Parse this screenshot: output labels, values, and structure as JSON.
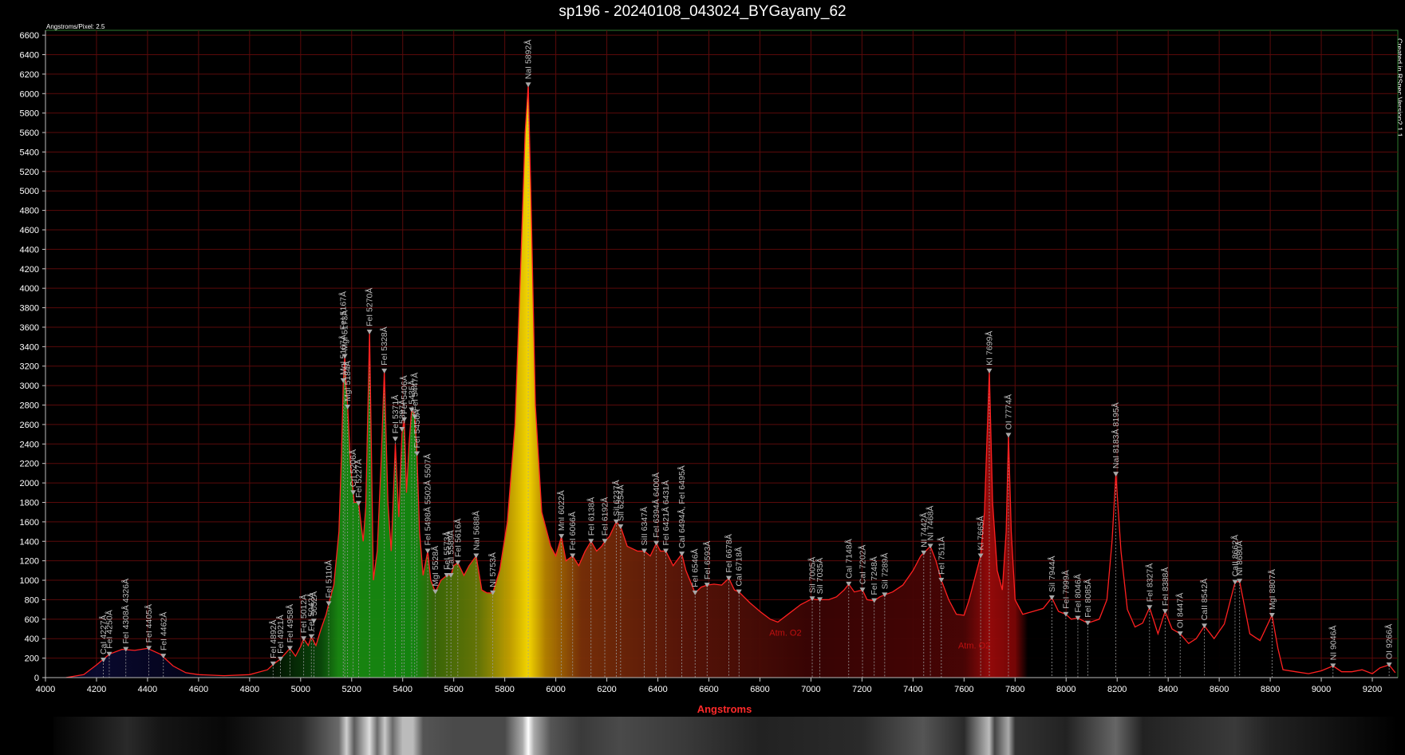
{
  "title": "sp196 - 20240108_043024_BYGayany_62",
  "subtitle": "Angstroms/Pixel: 2.5",
  "app_version": "Created in RSpec Version2.1.1",
  "colors": {
    "background": "#000000",
    "grid": "#5a0a0a",
    "spectrum_line": "#ff2020",
    "frame": "#2e7d2e",
    "axis_label": "#ff2a2a",
    "line_label": "#bdbdbd"
  },
  "chart_data": {
    "type": "line",
    "title": "sp196 - 20240108_043024_BYGayany_62",
    "xlabel": "Angstroms",
    "ylabel": "",
    "xlim": [
      4000,
      9300
    ],
    "ylim": [
      0,
      6650
    ],
    "grid": true,
    "x_ticks": [
      4000,
      4200,
      4400,
      4600,
      4800,
      5000,
      5200,
      5400,
      5600,
      5800,
      6000,
      6200,
      6400,
      6600,
      6800,
      7000,
      7200,
      7400,
      7600,
      7800,
      8000,
      8200,
      8400,
      8600,
      8800,
      9000,
      9200
    ],
    "y_ticks": [
      0,
      200,
      400,
      600,
      800,
      1000,
      1200,
      1400,
      1600,
      1800,
      2000,
      2200,
      2400,
      2600,
      2800,
      3000,
      3200,
      3400,
      3600,
      3800,
      4000,
      4200,
      4400,
      4600,
      4800,
      5000,
      5200,
      5400,
      5600,
      5800,
      6000,
      6200,
      6400,
      6600
    ],
    "series": [
      {
        "points": [
          [
            4080,
            0
          ],
          [
            4150,
            30
          ],
          [
            4200,
            130
          ],
          [
            4250,
            240
          ],
          [
            4300,
            290
          ],
          [
            4350,
            280
          ],
          [
            4400,
            300
          ],
          [
            4450,
            240
          ],
          [
            4500,
            120
          ],
          [
            4550,
            50
          ],
          [
            4600,
            30
          ],
          [
            4700,
            20
          ],
          [
            4800,
            30
          ],
          [
            4870,
            80
          ],
          [
            4895,
            140
          ],
          [
            4921,
            190
          ],
          [
            4958,
            300
          ],
          [
            4980,
            220
          ],
          [
            5000,
            320
          ],
          [
            5012,
            400
          ],
          [
            5030,
            330
          ],
          [
            5042,
            420
          ],
          [
            5060,
            330
          ],
          [
            5080,
            500
          ],
          [
            5100,
            650
          ],
          [
            5110,
            760
          ],
          [
            5130,
            950
          ],
          [
            5150,
            1500
          ],
          [
            5160,
            2300
          ],
          [
            5167,
            3000
          ],
          [
            5173,
            3300
          ],
          [
            5178,
            3000
          ],
          [
            5184,
            2800
          ],
          [
            5195,
            2200
          ],
          [
            5210,
            1800
          ],
          [
            5227,
            1800
          ],
          [
            5245,
            1400
          ],
          [
            5255,
            1750
          ],
          [
            5270,
            3550
          ],
          [
            5285,
            1000
          ],
          [
            5300,
            1300
          ],
          [
            5315,
            2200
          ],
          [
            5328,
            3150
          ],
          [
            5342,
            1800
          ],
          [
            5355,
            1300
          ],
          [
            5371,
            2400
          ],
          [
            5385,
            1650
          ],
          [
            5397,
            2500
          ],
          [
            5406,
            2650
          ],
          [
            5415,
            1900
          ],
          [
            5425,
            2400
          ],
          [
            5435,
            2750
          ],
          [
            5447,
            2700
          ],
          [
            5456,
            2300
          ],
          [
            5466,
            1500
          ],
          [
            5480,
            1050
          ],
          [
            5498,
            1300
          ],
          [
            5510,
            1000
          ],
          [
            5528,
            880
          ],
          [
            5550,
            1000
          ],
          [
            5573,
            1050
          ],
          [
            5589,
            1050
          ],
          [
            5600,
            1150
          ],
          [
            5616,
            1180
          ],
          [
            5640,
            1050
          ],
          [
            5660,
            1150
          ],
          [
            5688,
            1250
          ],
          [
            5710,
            900
          ],
          [
            5730,
            870
          ],
          [
            5753,
            870
          ],
          [
            5780,
            1100
          ],
          [
            5810,
            1600
          ],
          [
            5840,
            2600
          ],
          [
            5862,
            4200
          ],
          [
            5880,
            5600
          ],
          [
            5892,
            6090
          ],
          [
            5902,
            5000
          ],
          [
            5920,
            2800
          ],
          [
            5945,
            1700
          ],
          [
            5980,
            1350
          ],
          [
            6000,
            1250
          ],
          [
            6022,
            1450
          ],
          [
            6040,
            1200
          ],
          [
            6066,
            1250
          ],
          [
            6090,
            1150
          ],
          [
            6115,
            1300
          ],
          [
            6138,
            1400
          ],
          [
            6160,
            1300
          ],
          [
            6180,
            1350
          ],
          [
            6192,
            1400
          ],
          [
            6210,
            1450
          ],
          [
            6237,
            1600
          ],
          [
            6254,
            1550
          ],
          [
            6280,
            1350
          ],
          [
            6320,
            1300
          ],
          [
            6347,
            1300
          ],
          [
            6370,
            1250
          ],
          [
            6394,
            1380
          ],
          [
            6410,
            1300
          ],
          [
            6431,
            1300
          ],
          [
            6460,
            1150
          ],
          [
            6494,
            1270
          ],
          [
            6510,
            1100
          ],
          [
            6546,
            870
          ],
          [
            6570,
            930
          ],
          [
            6593,
            950
          ],
          [
            6620,
            960
          ],
          [
            6650,
            950
          ],
          [
            6678,
            1020
          ],
          [
            6700,
            900
          ],
          [
            6718,
            880
          ],
          [
            6760,
            770
          ],
          [
            6800,
            680
          ],
          [
            6840,
            600
          ],
          [
            6870,
            570
          ],
          [
            6910,
            650
          ],
          [
            6960,
            750
          ],
          [
            7005,
            810
          ],
          [
            7020,
            800
          ],
          [
            7035,
            800
          ],
          [
            7070,
            800
          ],
          [
            7100,
            830
          ],
          [
            7130,
            900
          ],
          [
            7148,
            960
          ],
          [
            7170,
            880
          ],
          [
            7202,
            900
          ],
          [
            7220,
            800
          ],
          [
            7248,
            790
          ],
          [
            7270,
            830
          ],
          [
            7289,
            850
          ],
          [
            7320,
            880
          ],
          [
            7360,
            950
          ],
          [
            7400,
            1100
          ],
          [
            7430,
            1250
          ],
          [
            7442,
            1280
          ],
          [
            7468,
            1350
          ],
          [
            7490,
            1200
          ],
          [
            7511,
            1000
          ],
          [
            7540,
            800
          ],
          [
            7570,
            650
          ],
          [
            7600,
            640
          ],
          [
            7620,
            800
          ],
          [
            7640,
            1000
          ],
          [
            7665,
            1250
          ],
          [
            7680,
            1700
          ],
          [
            7699,
            3150
          ],
          [
            7712,
            1800
          ],
          [
            7730,
            1100
          ],
          [
            7750,
            900
          ],
          [
            7765,
            1500
          ],
          [
            7774,
            2490
          ],
          [
            7785,
            1500
          ],
          [
            7800,
            800
          ],
          [
            7830,
            650
          ],
          [
            7870,
            680
          ],
          [
            7910,
            710
          ],
          [
            7944,
            820
          ],
          [
            7970,
            680
          ],
          [
            7999,
            650
          ],
          [
            8020,
            600
          ],
          [
            8046,
            610
          ],
          [
            8085,
            560
          ],
          [
            8130,
            600
          ],
          [
            8160,
            800
          ],
          [
            8180,
            1400
          ],
          [
            8195,
            2090
          ],
          [
            8215,
            1300
          ],
          [
            8240,
            700
          ],
          [
            8270,
            520
          ],
          [
            8300,
            560
          ],
          [
            8327,
            720
          ],
          [
            8360,
            450
          ],
          [
            8388,
            680
          ],
          [
            8415,
            500
          ],
          [
            8447,
            450
          ],
          [
            8480,
            350
          ],
          [
            8510,
            400
          ],
          [
            8542,
            530
          ],
          [
            8580,
            400
          ],
          [
            8620,
            550
          ],
          [
            8662,
            980
          ],
          [
            8680,
            990
          ],
          [
            8720,
            450
          ],
          [
            8760,
            380
          ],
          [
            8807,
            640
          ],
          [
            8830,
            300
          ],
          [
            8850,
            80
          ],
          [
            8900,
            60
          ],
          [
            8950,
            40
          ],
          [
            9000,
            70
          ],
          [
            9046,
            120
          ],
          [
            9080,
            60
          ],
          [
            9120,
            60
          ],
          [
            9160,
            80
          ],
          [
            9200,
            40
          ],
          [
            9230,
            100
          ],
          [
            9266,
            130
          ],
          [
            9290,
            50
          ]
        ]
      }
    ],
    "markers": [
      {
        "x": 4227,
        "y": 180,
        "label": "CaI 4227Å"
      },
      {
        "x": 4250,
        "y": 240,
        "label": "FeI 4250Å"
      },
      {
        "x": 4315,
        "y": 290,
        "label": "FeI 4308Å 4326Å"
      },
      {
        "x": 4405,
        "y": 300,
        "label": "FeI 4405Å"
      },
      {
        "x": 4462,
        "y": 220,
        "label": "FeI 4462Å"
      },
      {
        "x": 4892,
        "y": 140,
        "label": "FeI 4892Å"
      },
      {
        "x": 4921,
        "y": 190,
        "label": "FeI 4921Å"
      },
      {
        "x": 4958,
        "y": 300,
        "label": "FeI 4958Å"
      },
      {
        "x": 5012,
        "y": 400,
        "label": "FeI 5012Å"
      },
      {
        "x": 5042,
        "y": 420,
        "label": "FeI 5042Å"
      },
      {
        "x": 5052,
        "y": 580,
        "label": "5052Å"
      },
      {
        "x": 5110,
        "y": 760,
        "label": "FeI 5110Å"
      },
      {
        "x": 5167,
        "y": 3050,
        "label": "MgI 5167Å, FeI 5167Å"
      },
      {
        "x": 5173,
        "y": 3300,
        "label": "MgI 5173Å"
      },
      {
        "x": 5184,
        "y": 2780,
        "label": "MgI 5184Å"
      },
      {
        "x": 5206,
        "y": 1900,
        "label": "CrI 5206Å"
      },
      {
        "x": 5227,
        "y": 1790,
        "label": "FeI 5227Å"
      },
      {
        "x": 5270,
        "y": 3550,
        "label": "FeI 5270Å"
      },
      {
        "x": 5328,
        "y": 3150,
        "label": "FeI 5328Å"
      },
      {
        "x": 5371,
        "y": 2450,
        "label": "FeI 5371Å"
      },
      {
        "x": 5397,
        "y": 2550,
        "label": "5397Å"
      },
      {
        "x": 5406,
        "y": 2650,
        "label": "FeI 5406Å"
      },
      {
        "x": 5435,
        "y": 2750,
        "label": "5435Å"
      },
      {
        "x": 5447,
        "y": 2680,
        "label": "FeI 5447Å"
      },
      {
        "x": 5456,
        "y": 2300,
        "label": "FeI 5456Å"
      },
      {
        "x": 5498,
        "y": 1300,
        "label": "FeI 5498Å 5502Å 5507Å"
      },
      {
        "x": 5528,
        "y": 880,
        "label": "MgI 5528Å"
      },
      {
        "x": 5573,
        "y": 1050,
        "label": "FeI 5573Å"
      },
      {
        "x": 5589,
        "y": 1050,
        "label": "CaI 5589Å"
      },
      {
        "x": 5616,
        "y": 1180,
        "label": "FeI 5616Å"
      },
      {
        "x": 5688,
        "y": 1250,
        "label": "NaI 5688Å"
      },
      {
        "x": 5753,
        "y": 870,
        "label": "NI 5753Å"
      },
      {
        "x": 5892,
        "y": 6090,
        "label": "NaI 5892Å"
      },
      {
        "x": 6022,
        "y": 1450,
        "label": "MnI 6022Å"
      },
      {
        "x": 6066,
        "y": 1250,
        "label": "FeI 6066Å"
      },
      {
        "x": 6138,
        "y": 1400,
        "label": "FeI 6138Å"
      },
      {
        "x": 6192,
        "y": 1400,
        "label": "FeI 6192Å"
      },
      {
        "x": 6237,
        "y": 1600,
        "label": "SiI 6237Å"
      },
      {
        "x": 6254,
        "y": 1550,
        "label": "SiI 6254Å"
      },
      {
        "x": 6347,
        "y": 1300,
        "label": "SiII 6347Å"
      },
      {
        "x": 6394,
        "y": 1380,
        "label": "FeI 6394Å 6400Å"
      },
      {
        "x": 6431,
        "y": 1300,
        "label": "FeI 6421Å 6431Å"
      },
      {
        "x": 6494,
        "y": 1270,
        "label": "CaI 6494Å, FeI 6495Å"
      },
      {
        "x": 6546,
        "y": 870,
        "label": "FeI 6546Å"
      },
      {
        "x": 6593,
        "y": 950,
        "label": "FeI 6593Å"
      },
      {
        "x": 6678,
        "y": 1020,
        "label": "FeI 6678Å"
      },
      {
        "x": 6718,
        "y": 880,
        "label": "CaI 6718Å"
      },
      {
        "x": 7005,
        "y": 810,
        "label": "SiI 7005Å"
      },
      {
        "x": 7035,
        "y": 800,
        "label": "SiI 7035Å"
      },
      {
        "x": 7148,
        "y": 960,
        "label": "CaI 7148Å"
      },
      {
        "x": 7202,
        "y": 900,
        "label": "CaI 7202Å"
      },
      {
        "x": 7248,
        "y": 790,
        "label": "FeI 7248Å"
      },
      {
        "x": 7289,
        "y": 850,
        "label": "SiI 7289Å"
      },
      {
        "x": 7442,
        "y": 1280,
        "label": "NI 7442Å"
      },
      {
        "x": 7468,
        "y": 1350,
        "label": "NI 7468Å"
      },
      {
        "x": 7511,
        "y": 1000,
        "label": "FeI 7511Å"
      },
      {
        "x": 7665,
        "y": 1250,
        "label": "KI 7665Å"
      },
      {
        "x": 7699,
        "y": 3150,
        "label": "KI 7699Å"
      },
      {
        "x": 7774,
        "y": 2490,
        "label": "OI 7774Å"
      },
      {
        "x": 7944,
        "y": 820,
        "label": "SiI 7944Å"
      },
      {
        "x": 7999,
        "y": 650,
        "label": "FeI 7999Å"
      },
      {
        "x": 8046,
        "y": 610,
        "label": "FeI 8046Å"
      },
      {
        "x": 8085,
        "y": 560,
        "label": "FeI 8085Å"
      },
      {
        "x": 8195,
        "y": 2090,
        "label": "NaI 8183Å 8195Å"
      },
      {
        "x": 8327,
        "y": 720,
        "label": "FeI 8327Å"
      },
      {
        "x": 8388,
        "y": 680,
        "label": "FeI 8388Å"
      },
      {
        "x": 8447,
        "y": 450,
        "label": "OI 8447Å"
      },
      {
        "x": 8542,
        "y": 530,
        "label": "CaII 8542Å"
      },
      {
        "x": 8662,
        "y": 980,
        "label": "CaII 8662Å"
      },
      {
        "x": 8680,
        "y": 990,
        "label": "NI 8680Å"
      },
      {
        "x": 8807,
        "y": 640,
        "label": "MgI 8807Å"
      },
      {
        "x": 9046,
        "y": 120,
        "label": "NI 9046Å"
      },
      {
        "x": 9266,
        "y": 130,
        "label": "OI 9266Å"
      }
    ],
    "annotations": [
      {
        "x": 6900,
        "y": 430,
        "text": "Atm. O2"
      },
      {
        "x": 7640,
        "y": 300,
        "text": "Atm. O2"
      }
    ]
  }
}
